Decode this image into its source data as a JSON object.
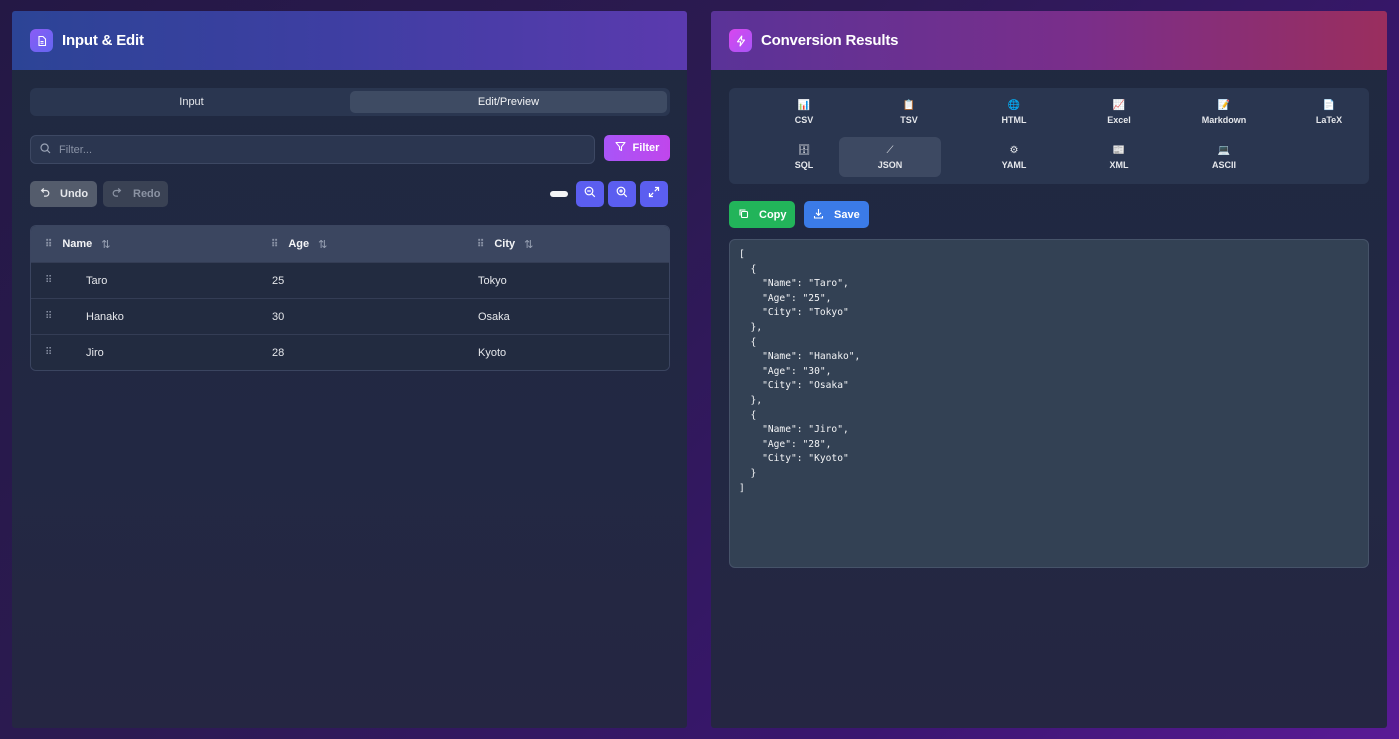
{
  "left_panel": {
    "title": "Input & Edit",
    "tabs": [
      {
        "label": "Input",
        "active": false
      },
      {
        "label": "Edit/Preview",
        "active": true
      }
    ],
    "filter": {
      "placeholder": "Filter...",
      "button_label": "Filter"
    },
    "undo_label": "Undo",
    "redo_label": "Redo",
    "table": {
      "columns": [
        "Name",
        "Age",
        "City"
      ],
      "rows": [
        [
          "Taro",
          "25",
          "Tokyo"
        ],
        [
          "Hanako",
          "30",
          "Osaka"
        ],
        [
          "Jiro",
          "28",
          "Kyoto"
        ]
      ]
    }
  },
  "right_panel": {
    "title": "Conversion Results",
    "formats": [
      {
        "label": "CSV",
        "icon": "📊"
      },
      {
        "label": "TSV",
        "icon": "📋"
      },
      {
        "label": "HTML",
        "icon": "🌐"
      },
      {
        "label": "Excel",
        "icon": "📈"
      },
      {
        "label": "Markdown",
        "icon": "📝"
      },
      {
        "label": "LaTeX",
        "icon": "📄"
      },
      {
        "label": "SQL",
        "icon": "🗄"
      },
      {
        "label": "JSON",
        "icon": "⟋"
      },
      {
        "label": "YAML",
        "icon": "⚙"
      },
      {
        "label": "XML",
        "icon": "📰"
      },
      {
        "label": "ASCII",
        "icon": "💻"
      }
    ],
    "active_format": "JSON",
    "copy_label": "Copy",
    "save_label": "Save",
    "output": "[\n  {\n    \"Name\": \"Taro\",\n    \"Age\": \"25\",\n    \"City\": \"Tokyo\"\n  },\n  {\n    \"Name\": \"Hanako\",\n    \"Age\": \"30\",\n    \"City\": \"Osaka\"\n  },\n  {\n    \"Name\": \"Jiro\",\n    \"Age\": \"28\",\n    \"City\": \"Kyoto\"\n  }\n]"
  },
  "colors": {
    "filter_button": "#a855f7",
    "zoom_button": "#5b5ef0",
    "copy_button": "#22b45a",
    "save_button": "#3b7be8"
  }
}
